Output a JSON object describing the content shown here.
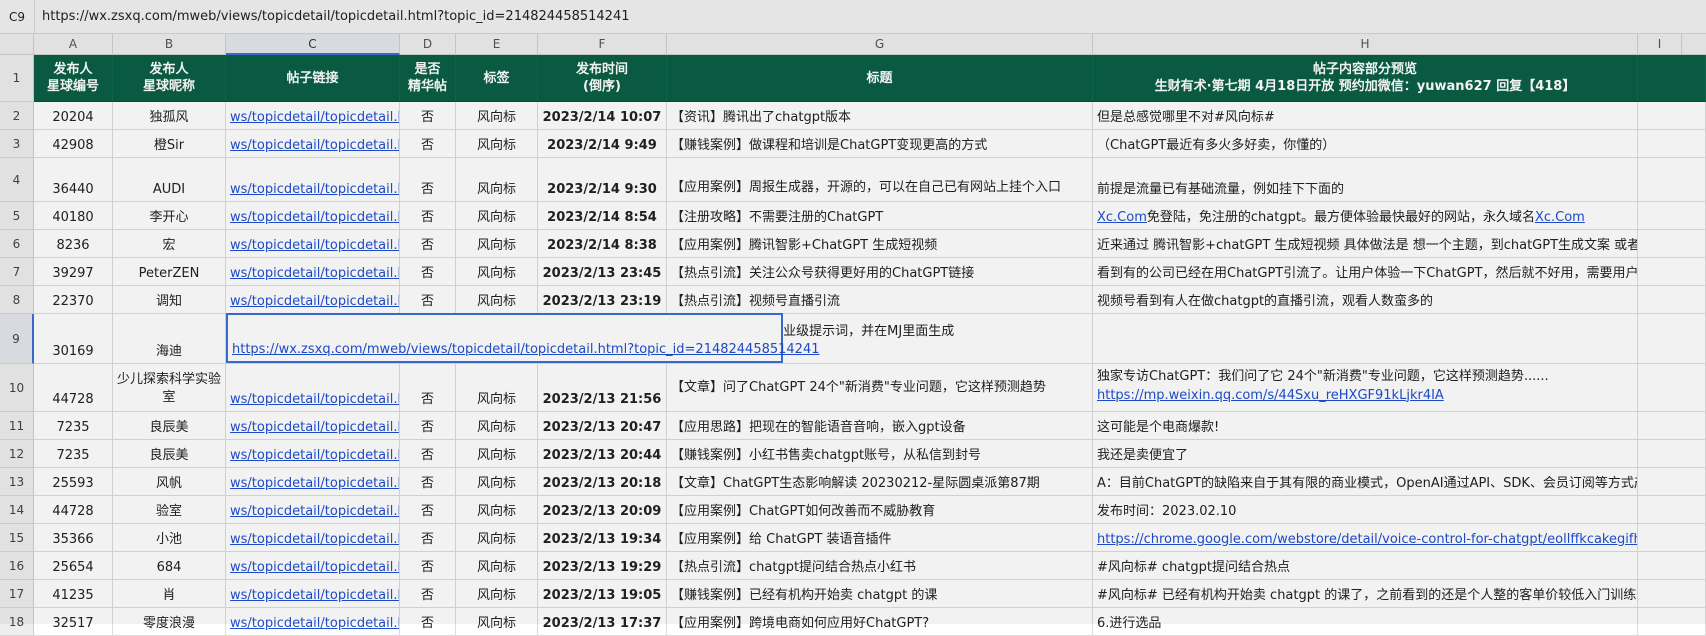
{
  "formula_bar": {
    "cell_ref": "C9",
    "content": "https://wx.zsxq.com/mweb/views/topicdetail/topicdetail.html?topic_id=214824458514241"
  },
  "columns": [
    "A",
    "B",
    "C",
    "D",
    "E",
    "F",
    "G",
    "H",
    "I"
  ],
  "header": {
    "row_num": "1",
    "a": "发布人\n星球编号",
    "b": "发布人\n星球昵称",
    "c": "帖子链接",
    "d": "是否\n精华帖",
    "e": "标签",
    "f": "发布时间\n(倒序)",
    "g": "标题",
    "h": "帖子内容部分预览\n生财有术·第七期 4月18日开放 预约加微信：yuwan627 回复【418】"
  },
  "rows": [
    {
      "n": "2",
      "a": "20204",
      "b": "独孤风",
      "c": "ws/topicdetail/topicdetail.htm",
      "d": "否",
      "e": "风向标",
      "f": "2023/2/14 10:07",
      "g": "【资讯】腾讯出了chatgpt版本",
      "h": "但是总感觉哪里不对#风向标#"
    },
    {
      "n": "3",
      "a": "42908",
      "b": "橙Sir",
      "c": "ws/topicdetail/topicdetail.htm",
      "d": "否",
      "e": "风向标",
      "f": "2023/2/14 9:49",
      "g": "【赚钱案例】做课程和培训是ChatGPT变现更高的方式",
      "h": "（ChatGPT最近有多火多好卖，你懂的）"
    },
    {
      "n": "4",
      "a": "36440",
      "b": "AUDI",
      "c": "ws/topicdetail/topicdetail.htm",
      "d": "否",
      "e": "风向标",
      "f": "2023/2/14 9:30",
      "g": "【应用案例】周报生成器，开源的，可以在自己已有网站上挂个入口",
      "h": "前提是流量已有基础流量，例如挂下下面的"
    },
    {
      "n": "5",
      "a": "40180",
      "b": "李开心",
      "c": "ws/topicdetail/topicdetail.htm",
      "d": "否",
      "e": "风向标",
      "f": "2023/2/14 8:54",
      "g": "【注册攻略】不需要注册的ChatGPT",
      "h_link1": "Xc.Com",
      "h": " 免登陆，免注册的chatgpt。最方便体验最快最好的网站，永久域名",
      "h_link2": "Xc.Com"
    },
    {
      "n": "6",
      "a": "8236",
      "b": "宏",
      "c": "ws/topicdetail/topicdetail.htm",
      "d": "否",
      "e": "风向标",
      "f": "2023/2/14 8:38",
      "g": "【应用案例】腾讯智影+ChatGPT 生成短视频",
      "h": "近来通过 腾讯智影+chatGPT 生成短视频 具体做法是 想一个主题，到chatGPT生成文案 或者自"
    },
    {
      "n": "7",
      "a": "39297",
      "b": "PeterZEN",
      "c": "ws/topicdetail/topicdetail.htm",
      "d": "否",
      "e": "风向标",
      "f": "2023/2/13 23:45",
      "g": "【热点引流】关注公众号获得更好用的ChatGPT链接",
      "h": "看到有的公司已经在用ChatGPT引流了。让用户体验一下ChatGPT，然后就不好用，需要用户关"
    },
    {
      "n": "8",
      "a": "22370",
      "b": "调知",
      "c": "ws/topicdetail/topicdetail.htm",
      "d": "否",
      "e": "风向标",
      "f": "2023/2/13 23:19",
      "g": "【热点引流】视频号直播引流",
      "h": "视频号看到有人在做chatgpt的直播引流，观看人数蛮多的"
    },
    {
      "n": "9",
      "a": "30169",
      "b": "海迪",
      "c": "",
      "d": "",
      "e": "",
      "f": "",
      "g": "hatGPT批量生成工业级提示词，并在MJ里面生成",
      "h": ""
    },
    {
      "n": "10",
      "a": "44728",
      "b": "少儿探索科学实验室",
      "c": "ws/topicdetail/topicdetail.htm",
      "d": "否",
      "e": "风向标",
      "f": "2023/2/13 21:56",
      "g": "【文章】问了ChatGPT 24个\"新消费\"专业问题，它这样预测趋势",
      "h": "独家专访ChatGPT：我们问了它 24个\"新消费\"专业问题，它这样预测趋势......",
      "h_link1": "https://mp.weixin.qq.com/s/44Sxu_reHXGF91kLjkr4IA"
    },
    {
      "n": "11",
      "a": "7235",
      "b": "良辰美",
      "c": "ws/topicdetail/topicdetail.htm",
      "d": "否",
      "e": "风向标",
      "f": "2023/2/13 20:47",
      "g": "【应用思路】把现在的智能语音音响，嵌入gpt设备",
      "h": "这可能是个电商爆款!"
    },
    {
      "n": "12",
      "a": "7235",
      "b": "良辰美",
      "c": "ws/topicdetail/topicdetail.htm",
      "d": "否",
      "e": "风向标",
      "f": "2023/2/13 20:44",
      "g": "【赚钱案例】小红书售卖chatgpt账号，从私信到封号",
      "h": "我还是卖便宜了"
    },
    {
      "n": "13",
      "a": "25593",
      "b": "风帆",
      "c": "ws/topicdetail/topicdetail.htm",
      "d": "否",
      "e": "风向标",
      "f": "2023/2/13 20:18",
      "g": "【文章】ChatGPT生态影响解读 20230212-星际圆桌派第87期",
      "h": "A：目前ChatGPT的缺陷来自于其有限的商业模式，OpenAI通过API、SDK、会员订阅等方式产"
    },
    {
      "n": "14",
      "a": "44728",
      "b": "验室",
      "c": "ws/topicdetail/topicdetail.htm",
      "d": "否",
      "e": "风向标",
      "f": "2023/2/13 20:09",
      "g": "【应用案例】ChatGPT如何改善而不威胁教育",
      "h": "发布时间：2023.02.10"
    },
    {
      "n": "15",
      "a": "35366",
      "b": "小池",
      "c": "ws/topicdetail/topicdetail.htm",
      "d": "否",
      "e": "风向标",
      "f": "2023/2/13 19:34",
      "g": "【应用案例】给 ChatGPT 装语音插件",
      "h_link1": "https://chrome.google.com/webstore/detail/voice-control-for-chatgpt/eollffkcakegifhacjnlnegohfo"
    },
    {
      "n": "16",
      "a": "25654",
      "b": "684",
      "c": "ws/topicdetail/topicdetail.htm",
      "d": "否",
      "e": "风向标",
      "f": "2023/2/13 19:29",
      "g": "【热点引流】chatgpt提问结合热点小红书",
      "h": "#风向标# chatgpt提问结合热点"
    },
    {
      "n": "17",
      "a": "41235",
      "b": "肖",
      "c": "ws/topicdetail/topicdetail.htm",
      "d": "否",
      "e": "风向标",
      "f": "2023/2/13 19:05",
      "g": "【赚钱案例】已经有机构开始卖 chatgpt 的课",
      "h": "#风向标# 已经有机构开始卖 chatgpt 的课了，之前看到的还是个人整的客单价较低入门训练营，"
    },
    {
      "n": "18",
      "a": "32517",
      "b": "零度浪漫",
      "c": "ws/topicdetail/topicdetail.htm",
      "d": "否",
      "e": "风向标",
      "f": "2023/2/13 17:37",
      "g": "【应用案例】跨境电商如何应用好ChatGPT?",
      "h": "6.进行选品"
    }
  ],
  "popup": {
    "link": "https://wx.zsxq.com/mweb/views/topicdetail/topicdetail.html?topic_id=214824458514241"
  }
}
